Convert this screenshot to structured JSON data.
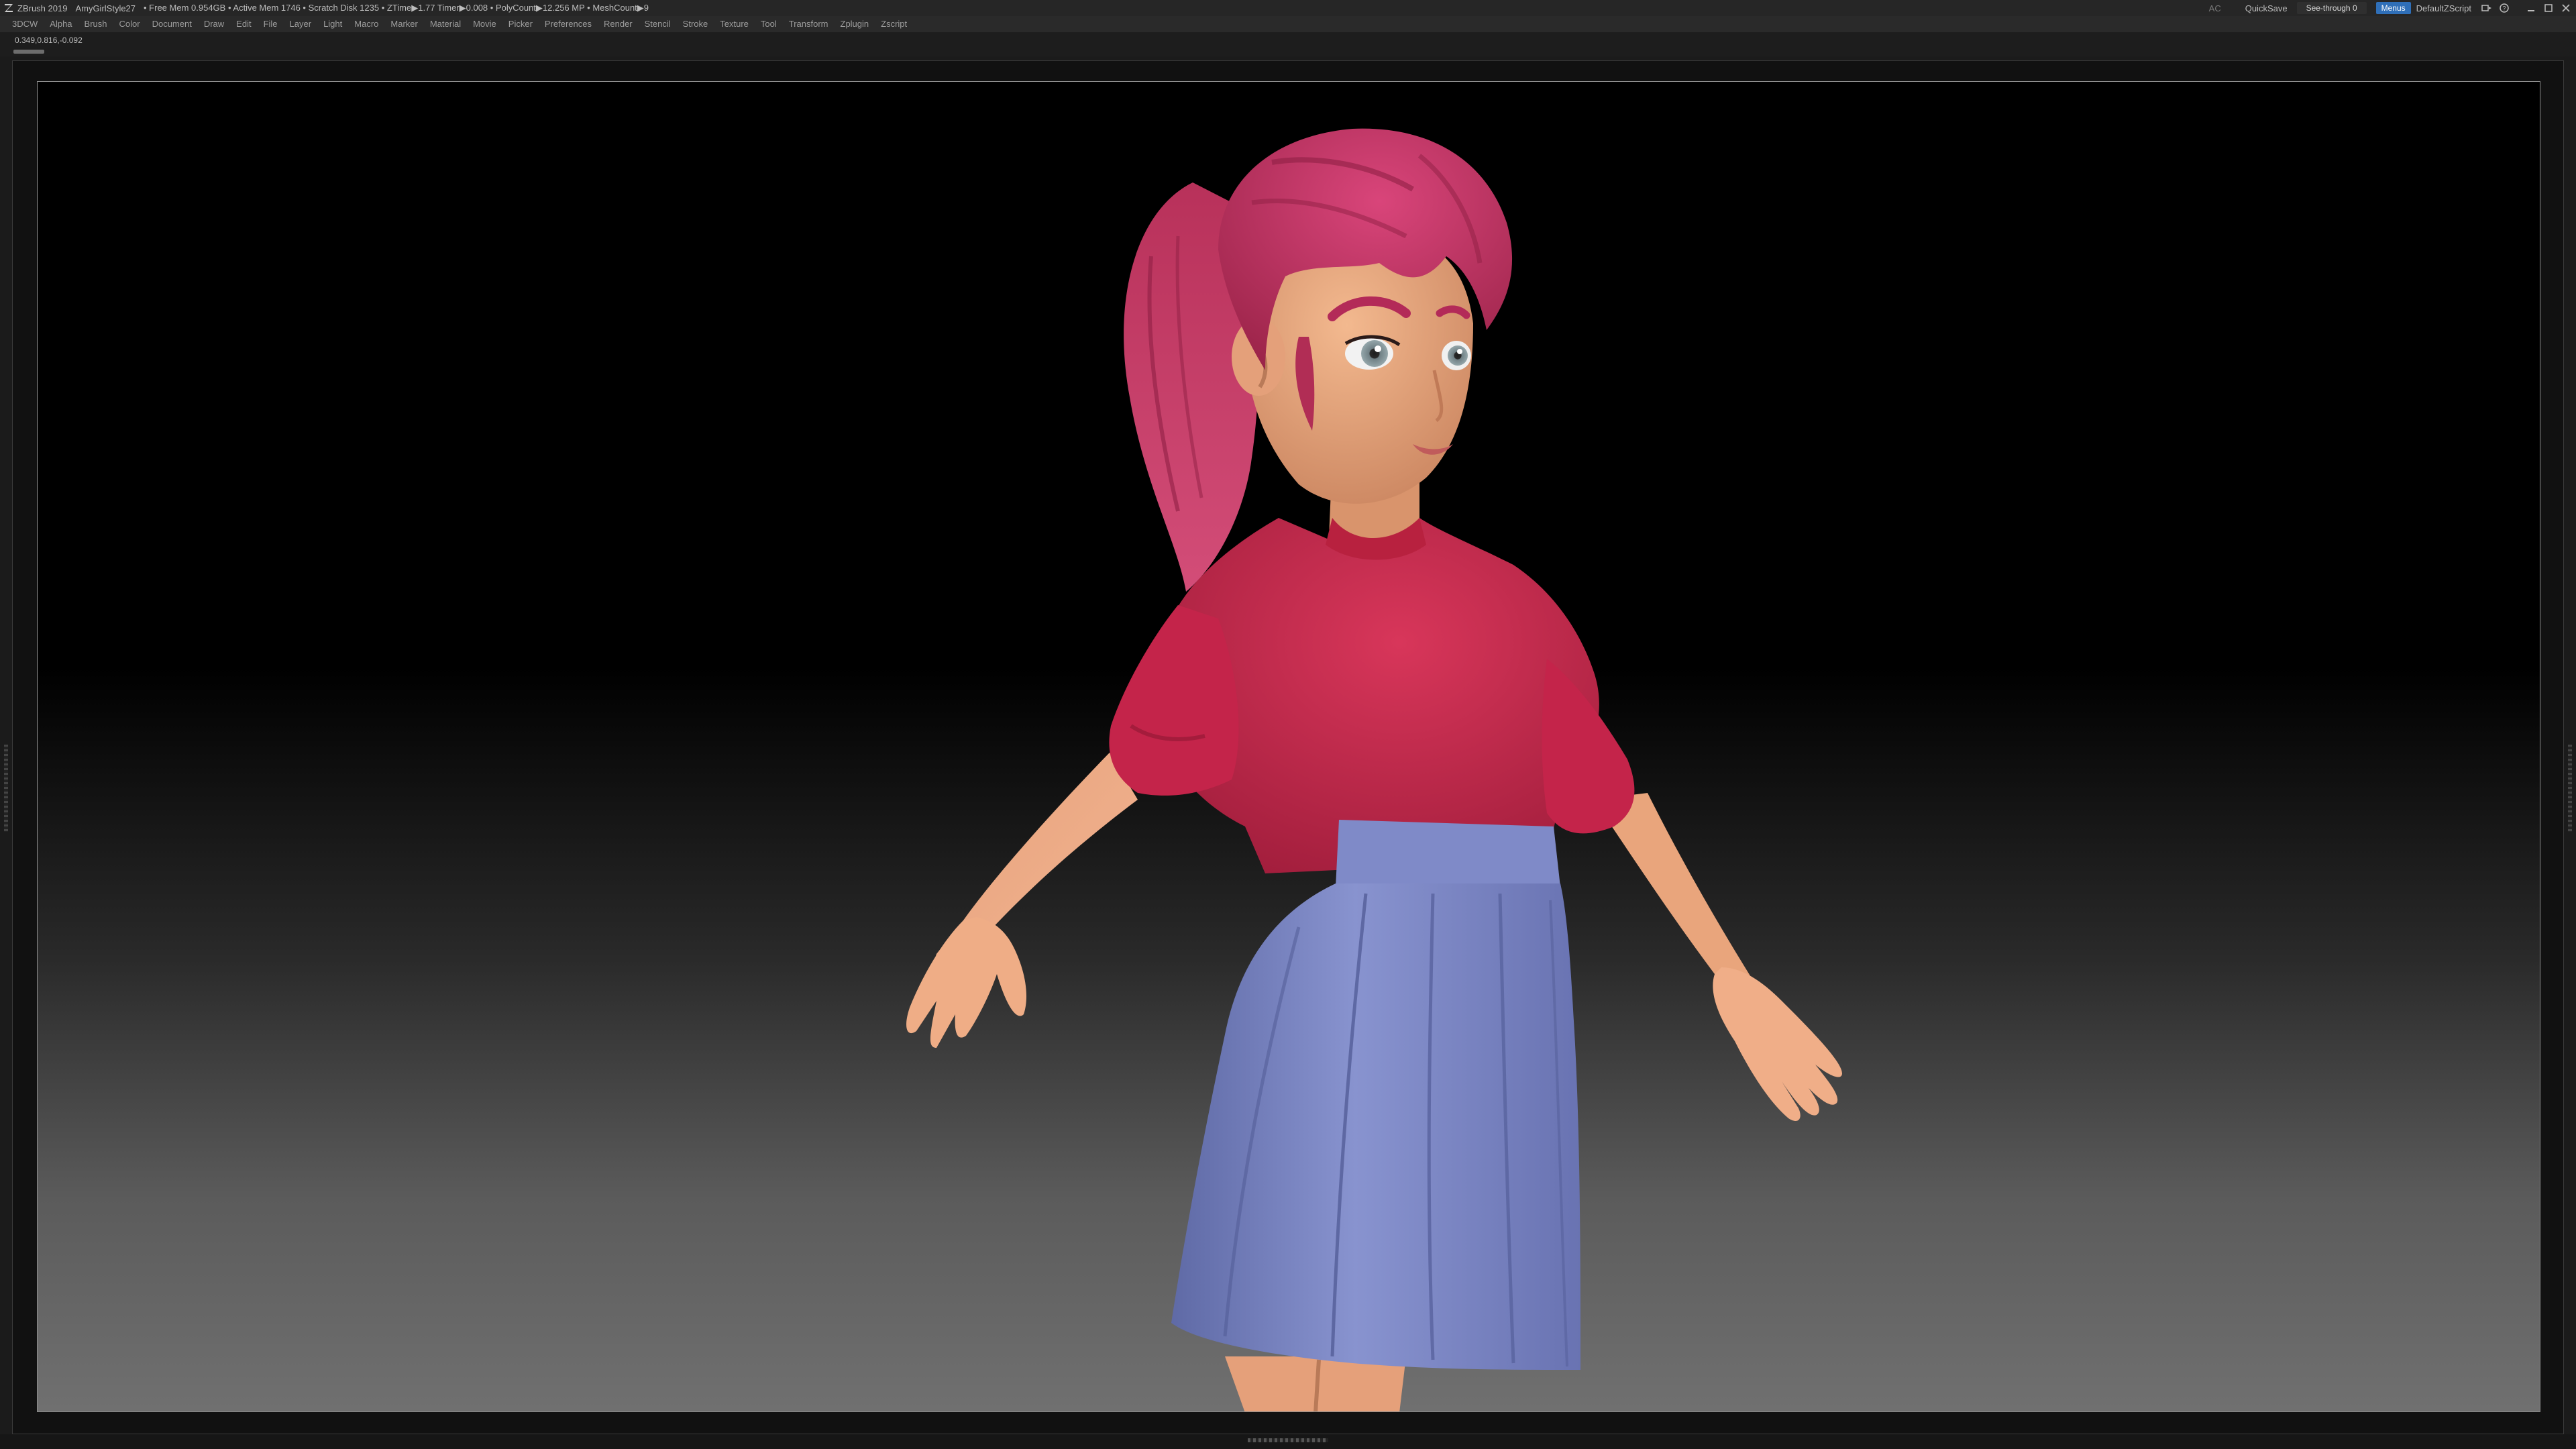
{
  "titlebar": {
    "app": "ZBrush 2019",
    "document": "AmyGirlStyle27",
    "stats": "• Free Mem 0.954GB • Active Mem 1746 • Scratch Disk 1235 • ZTime▶1.77 Timer▶0.008 • PolyCount▶12.256 MP • MeshCount▶9",
    "ac": "AC",
    "quicksave": "QuickSave",
    "see_through": "See-through 0",
    "see_through_value": 0,
    "menus": "Menus",
    "script": "DefaultZScript"
  },
  "menubar": {
    "items": [
      "3DCW",
      "Alpha",
      "Brush",
      "Color",
      "Document",
      "Draw",
      "Edit",
      "File",
      "Layer",
      "Light",
      "Macro",
      "Marker",
      "Material",
      "Movie",
      "Picker",
      "Preferences",
      "Render",
      "Stencil",
      "Stroke",
      "Texture",
      "Tool",
      "Transform",
      "Zplugin",
      "Zscript"
    ]
  },
  "infobar": {
    "coords": "0.349,0.816,-0.092"
  },
  "colors": {
    "accent_blue": "#2f6fb8",
    "hair": "#c2375f",
    "shirt": "#c7264b",
    "skirt": "#7b86c2",
    "skin": "#e9a57c"
  },
  "icons": [
    "zbrush-logo-icon",
    "palette-layout-icon",
    "help-icon",
    "minimize-icon",
    "restore-icon",
    "close-icon"
  ]
}
